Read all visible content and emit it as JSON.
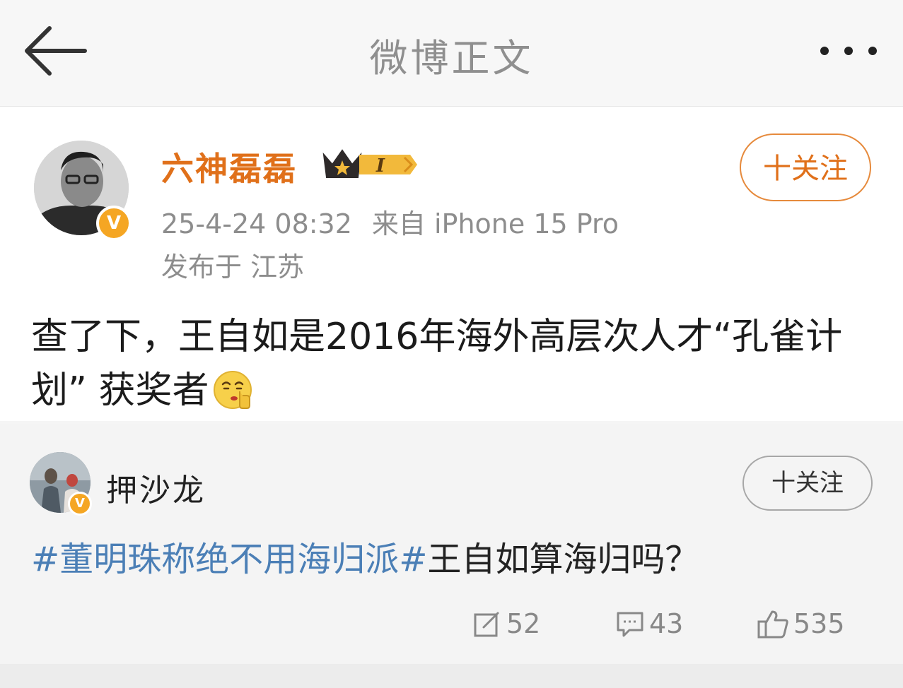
{
  "header": {
    "title": "微博正文"
  },
  "post": {
    "username": "六神磊磊",
    "vip_level": "I",
    "follow_label": "十关注",
    "time": "25-4-24 08:32",
    "source": "来自 iPhone 15 Pro",
    "location": "发布于 江苏",
    "text": "查了下，王自如是2016年海外高层次人才“孔雀计划” 获奖者"
  },
  "quote": {
    "username": "押沙龙",
    "follow_label": "十关注",
    "hashtag": "#董明珠称绝不用海归派#",
    "text": "王自如算海归吗？",
    "stats": {
      "reposts": "52",
      "comments": "43",
      "likes": "535"
    }
  },
  "colors": {
    "username_orange": "#e0701a",
    "hashtag_blue": "#4b7fb6",
    "verified_badge": "#f5a623"
  },
  "icons": [
    "back-arrow-icon",
    "more-icon",
    "crown-icon",
    "verified-icon",
    "shush-emoji-icon",
    "repost-icon",
    "comment-icon",
    "like-icon"
  ]
}
